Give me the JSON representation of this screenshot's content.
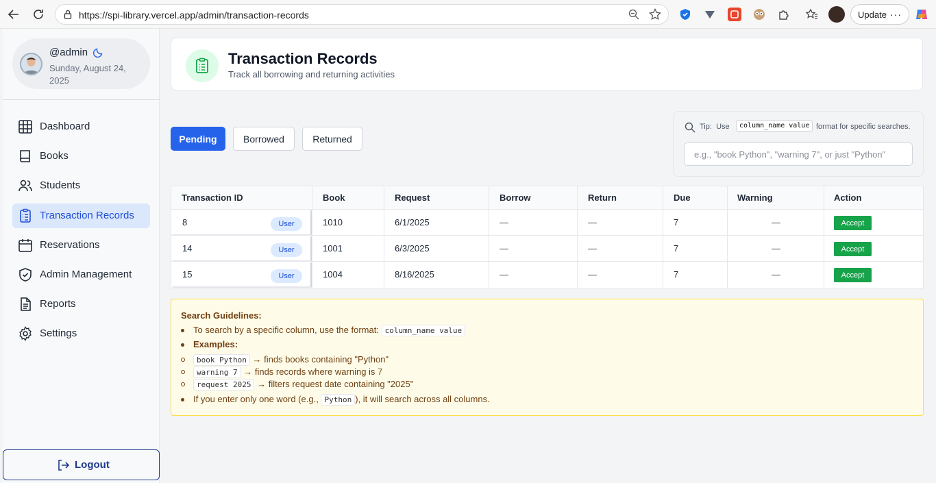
{
  "browser": {
    "url": "https://spi-library.vercel.app/admin/transaction-records",
    "update_label": "Update",
    "update_more": "···"
  },
  "sidebar": {
    "profile": {
      "name": "@admin",
      "date": "Sunday, August 24, 2025"
    },
    "items": [
      {
        "label": "Dashboard",
        "icon": "grid-icon"
      },
      {
        "label": "Books",
        "icon": "book-icon"
      },
      {
        "label": "Students",
        "icon": "users-icon"
      },
      {
        "label": "Transaction Records",
        "icon": "clipboard-icon",
        "active": true
      },
      {
        "label": "Reservations",
        "icon": "calendar-icon"
      },
      {
        "label": "Admin Management",
        "icon": "shield-icon"
      },
      {
        "label": "Reports",
        "icon": "file-icon"
      },
      {
        "label": "Settings",
        "icon": "gear-icon"
      }
    ],
    "logout_label": "Logout"
  },
  "header": {
    "title": "Transaction Records",
    "subtitle": "Track all borrowing and returning activities"
  },
  "tabs": [
    "Pending",
    "Borrowed",
    "Returned"
  ],
  "search": {
    "tip_label": "Tip:",
    "tip_use": "Use",
    "tip_code": "column_name value",
    "tip_suffix": "format for specific searches.",
    "placeholder": "e.g., \"book Python\", \"warning 7\", or just \"Python\""
  },
  "table": {
    "columns": [
      "Transaction ID",
      "Book",
      "Request",
      "Borrow",
      "Return",
      "Due",
      "Warning",
      "Action"
    ],
    "rows": [
      {
        "id": "8",
        "badge": "User",
        "book": "1010",
        "request": "6/1/2025",
        "borrow": "—",
        "return": "—",
        "due": "7",
        "warning": "—",
        "action": "Accept"
      },
      {
        "id": "14",
        "badge": "User",
        "book": "1001",
        "request": "6/3/2025",
        "borrow": "—",
        "return": "—",
        "due": "7",
        "warning": "—",
        "action": "Accept"
      },
      {
        "id": "15",
        "badge": "User",
        "book": "1004",
        "request": "8/16/2025",
        "borrow": "—",
        "return": "—",
        "due": "7",
        "warning": "—",
        "action": "Accept"
      }
    ]
  },
  "guidelines": {
    "title": "Search Guidelines:",
    "line1_text": "To search by a specific column, use the format:",
    "line1_code": "column_name value",
    "examples_label": "Examples:",
    "examples": [
      {
        "code": "book Python",
        "text": "→ finds books containing \"Python\""
      },
      {
        "code": "warning 7",
        "text": "→ finds records where warning is 7"
      },
      {
        "code": "request 2025",
        "text": "→ filters request date containing \"2025\""
      }
    ],
    "last_pre": "If you enter only one word (e.g.,",
    "last_code": "Python",
    "last_post": "), it will search across all columns."
  }
}
